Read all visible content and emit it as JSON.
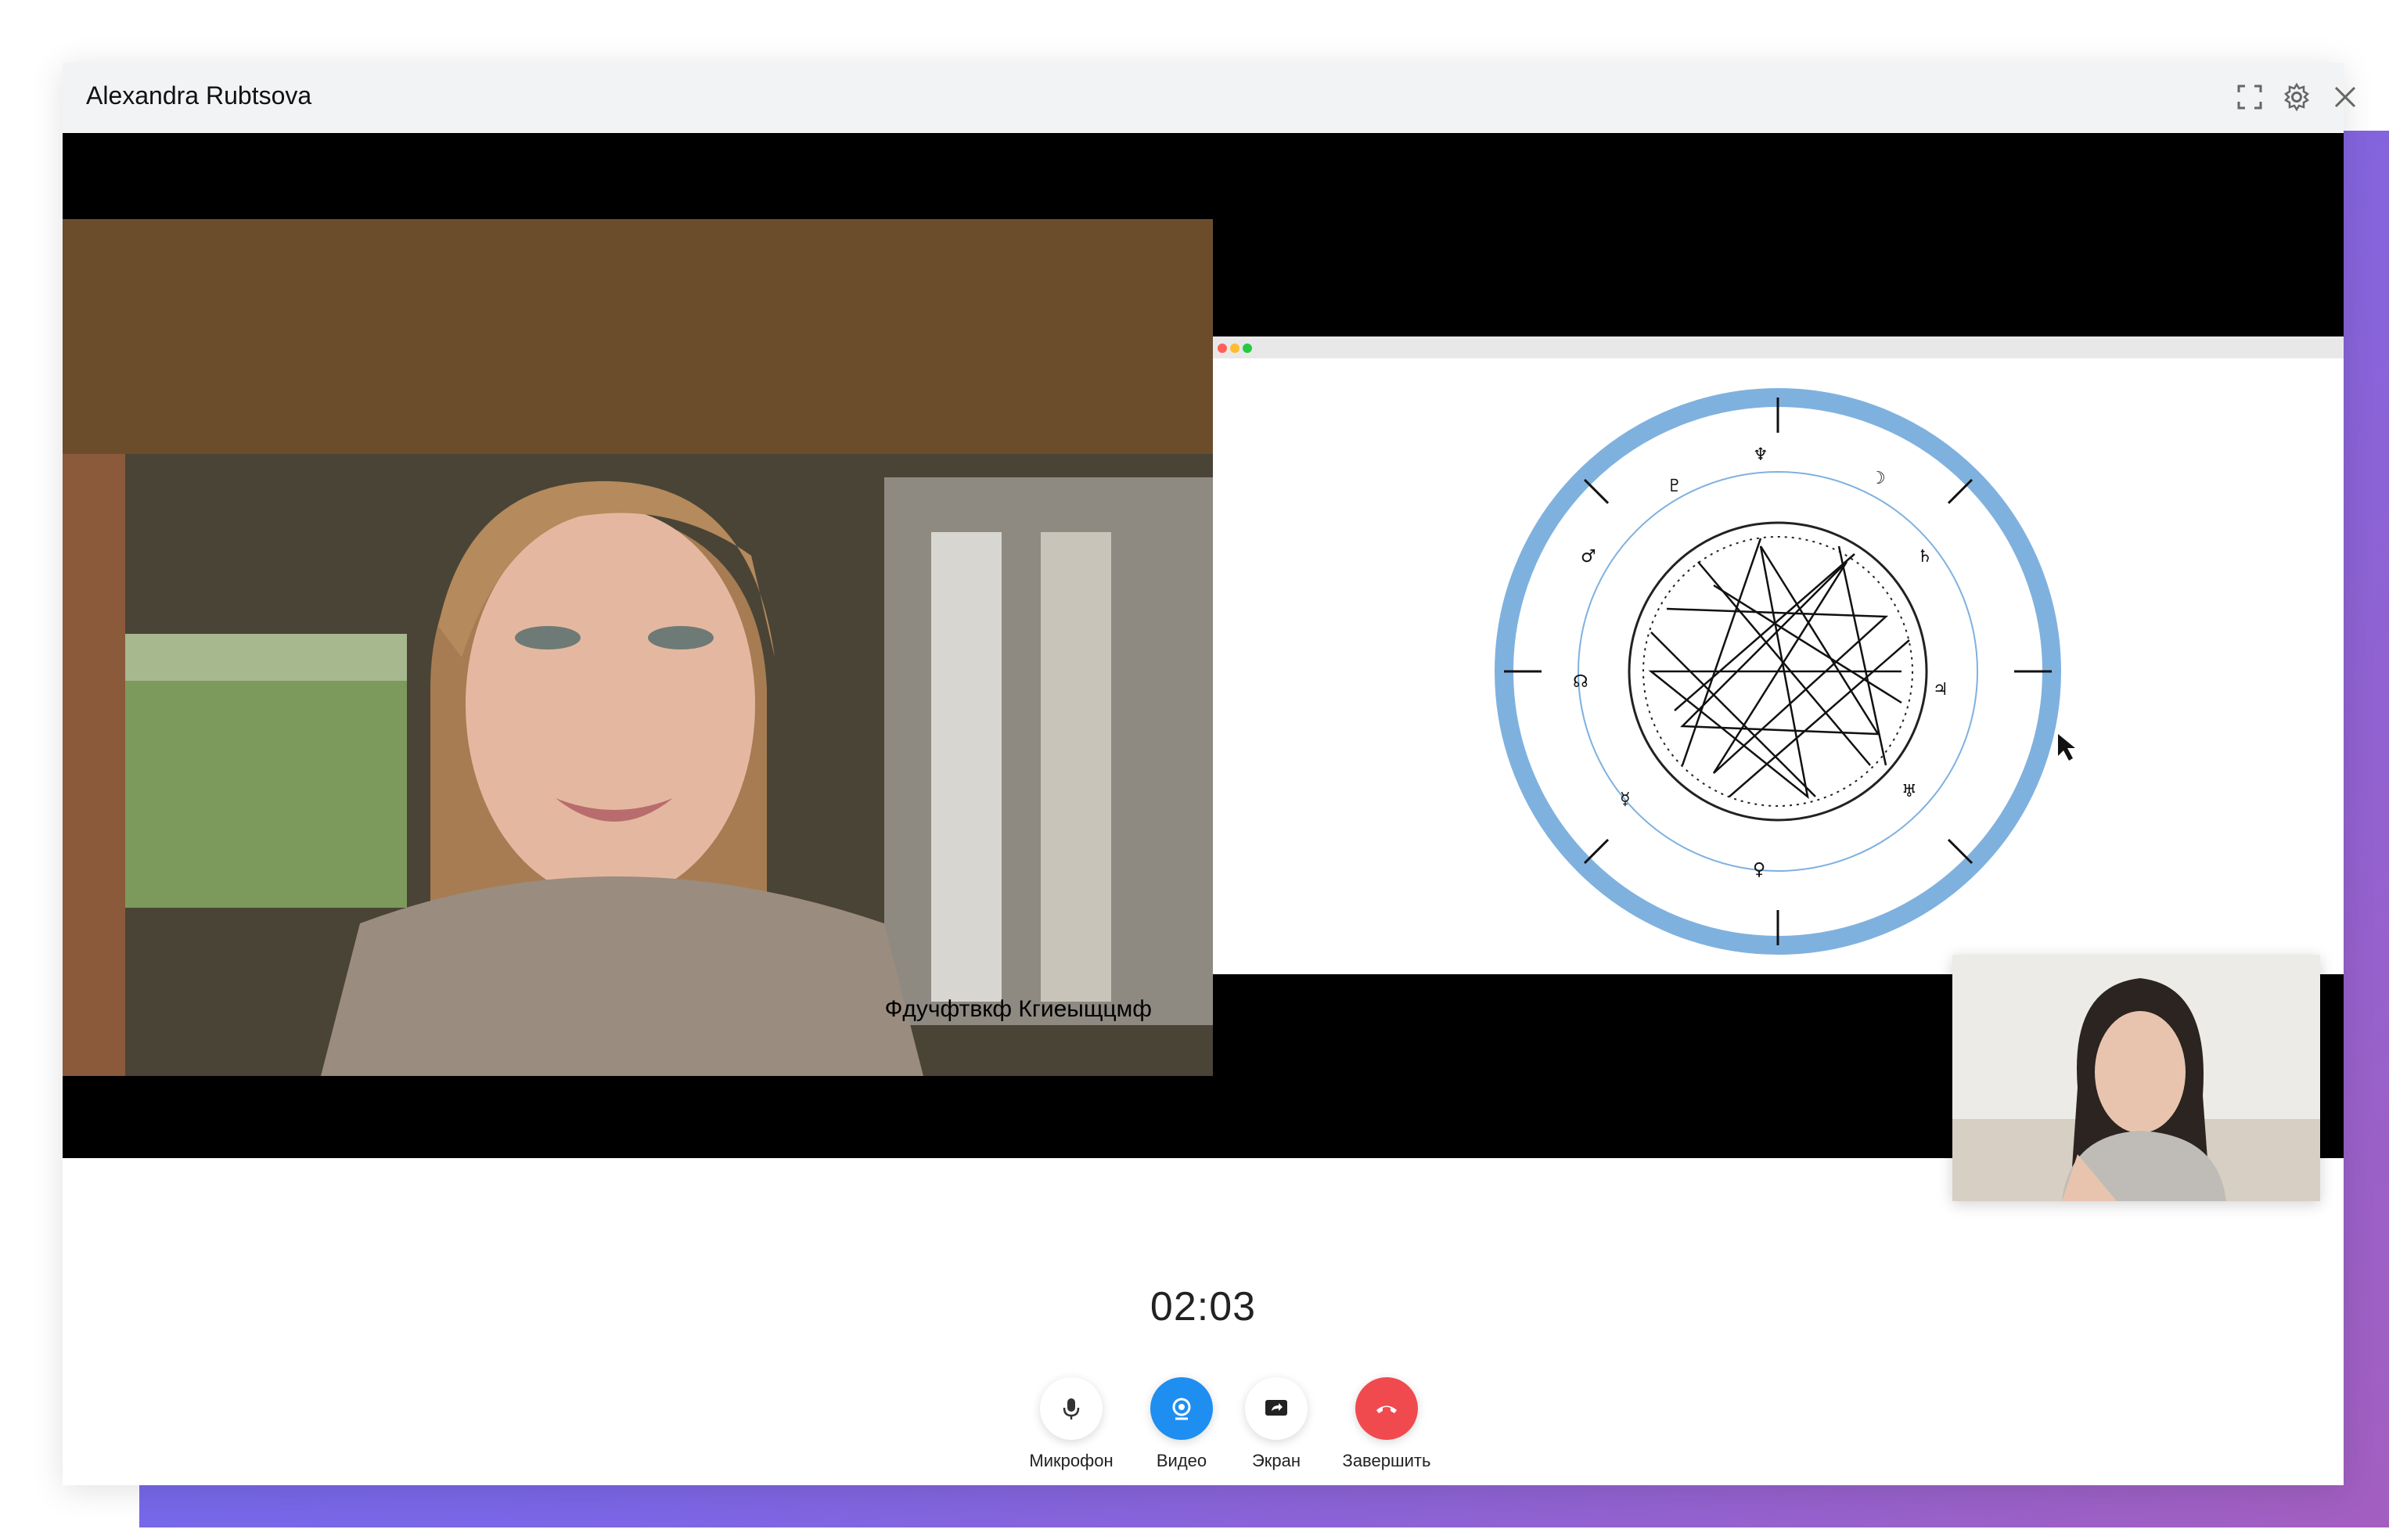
{
  "window": {
    "title": "Alexandra Rubtsova"
  },
  "icons": {
    "fullscreen": "fullscreen-icon",
    "settings": "gear-icon",
    "close": "close-icon",
    "mic": "microphone-icon",
    "video": "camera-icon",
    "screen": "screen-share-icon",
    "end": "hang-up-icon"
  },
  "main_feed": {
    "caption": "Фдучфтвкф Кгиеыщцмф"
  },
  "timer": "02:03",
  "controls": {
    "mic_label": "Микрофон",
    "video_label": "Видео",
    "screen_label": "Экран",
    "end_label": "Завершить"
  },
  "colors": {
    "video_active": "#1e8ff0",
    "end_call": "#f04a4f",
    "chart_ring": "#7fb1df",
    "gradient_start": "#6a6ff2",
    "gradient_end": "#a35fc0"
  }
}
